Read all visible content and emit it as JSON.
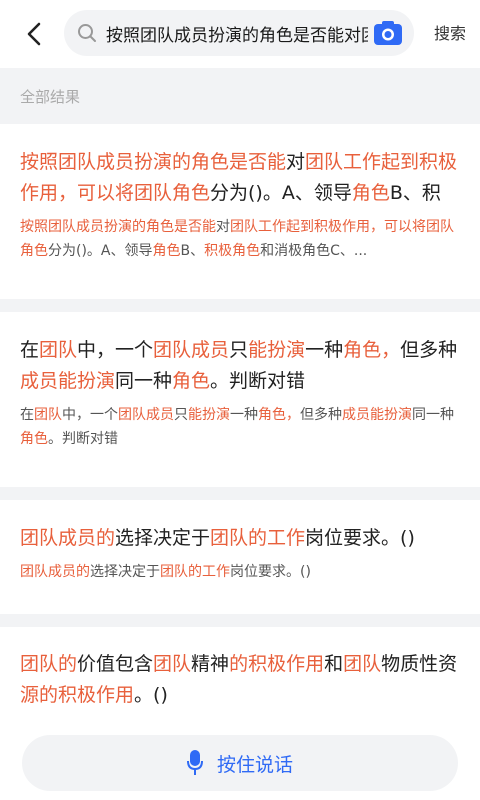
{
  "header": {
    "search_query": "按照团队成员扮演的角色是否能对团队工作起到积极作用，可以将团",
    "search_button": "搜索"
  },
  "section_label": "全部结果",
  "results": [
    {
      "title": [
        {
          "t": "按照团队成员扮演的角色是否能",
          "hl": true
        },
        {
          "t": "对",
          "hl": false
        },
        {
          "t": "团队工作起到积极作用，可以将团队角色",
          "hl": true
        },
        {
          "t": "分为()。A、领导",
          "hl": false
        },
        {
          "t": "角色",
          "hl": true
        },
        {
          "t": "B、积",
          "hl": false
        }
      ],
      "snippet": [
        {
          "t": "按照团队成员扮演的角色是否能",
          "hl": true
        },
        {
          "t": "对",
          "hl": false
        },
        {
          "t": "团队工作起到积极作用，可以将团队角色",
          "hl": true
        },
        {
          "t": "分为()。A、领导",
          "hl": false
        },
        {
          "t": "角色",
          "hl": true
        },
        {
          "t": "B、",
          "hl": false
        },
        {
          "t": "积极角色",
          "hl": true
        },
        {
          "t": "和消极角色C、...",
          "hl": false
        }
      ]
    },
    {
      "title": [
        {
          "t": "在",
          "hl": false
        },
        {
          "t": "团队",
          "hl": true
        },
        {
          "t": "中，一个",
          "hl": false
        },
        {
          "t": "团队成员",
          "hl": true
        },
        {
          "t": "只",
          "hl": false
        },
        {
          "t": "能扮演",
          "hl": true
        },
        {
          "t": "一种",
          "hl": false
        },
        {
          "t": "角色，",
          "hl": true
        },
        {
          "t": "但多种",
          "hl": false
        },
        {
          "t": "成员能扮演",
          "hl": true
        },
        {
          "t": "同一种",
          "hl": false
        },
        {
          "t": "角色",
          "hl": true
        },
        {
          "t": "。判断对错",
          "hl": false
        }
      ],
      "snippet": [
        {
          "t": "在",
          "hl": false
        },
        {
          "t": "团队",
          "hl": true
        },
        {
          "t": "中，一个",
          "hl": false
        },
        {
          "t": "团队成员",
          "hl": true
        },
        {
          "t": "只",
          "hl": false
        },
        {
          "t": "能扮演",
          "hl": true
        },
        {
          "t": "一种",
          "hl": false
        },
        {
          "t": "角色，",
          "hl": true
        },
        {
          "t": "但多种",
          "hl": false
        },
        {
          "t": "成员能扮演",
          "hl": true
        },
        {
          "t": "同一种",
          "hl": false
        },
        {
          "t": "角色",
          "hl": true
        },
        {
          "t": "。判断对错",
          "hl": false
        }
      ]
    },
    {
      "title": [
        {
          "t": "团队成员的",
          "hl": true
        },
        {
          "t": "选择决定于",
          "hl": false
        },
        {
          "t": "团队的工作",
          "hl": true
        },
        {
          "t": "岗位要求。()",
          "hl": false
        }
      ],
      "snippet": [
        {
          "t": "团队成员的",
          "hl": true
        },
        {
          "t": "选择决定于",
          "hl": false
        },
        {
          "t": "团队的工作",
          "hl": true
        },
        {
          "t": "岗位要求。()",
          "hl": false
        }
      ]
    },
    {
      "title": [
        {
          "t": "团队的",
          "hl": true
        },
        {
          "t": "价值包含",
          "hl": false
        },
        {
          "t": "团队",
          "hl": true
        },
        {
          "t": "精神",
          "hl": false
        },
        {
          "t": "的积极作用",
          "hl": true
        },
        {
          "t": "和",
          "hl": false
        },
        {
          "t": "团队",
          "hl": true
        },
        {
          "t": "物质性资",
          "hl": false
        },
        {
          "t": "源",
          "hl": true
        },
        {
          "t": "的积极作用",
          "hl": true
        },
        {
          "t": "。()",
          "hl": false
        }
      ],
      "snippet": []
    }
  ],
  "voice_button": "按住说话",
  "colors": {
    "highlight": "#e8603c",
    "accent_blue": "#2f6af5",
    "page_bg": "#f2f3f5"
  }
}
